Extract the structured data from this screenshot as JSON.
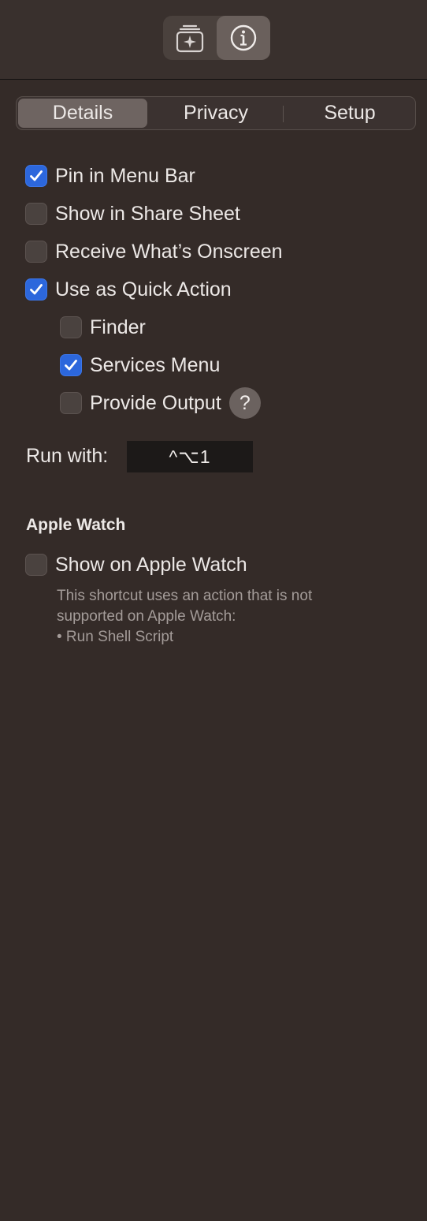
{
  "toolbar": {
    "icons": [
      {
        "name": "shortcut-details-icon",
        "selected": false
      },
      {
        "name": "info-icon",
        "selected": true
      }
    ]
  },
  "tabs": [
    {
      "label": "Details",
      "selected": true
    },
    {
      "label": "Privacy",
      "selected": false
    },
    {
      "label": "Setup",
      "selected": false
    }
  ],
  "options": {
    "pin_menu_bar": {
      "label": "Pin in Menu Bar",
      "checked": true
    },
    "share_sheet": {
      "label": "Show in Share Sheet",
      "checked": false
    },
    "onscreen": {
      "label": "Receive What’s Onscreen",
      "checked": false
    },
    "quick_action": {
      "label": "Use as Quick Action",
      "checked": true
    },
    "finder": {
      "label": "Finder",
      "checked": false
    },
    "services_menu": {
      "label": "Services Menu",
      "checked": true
    },
    "provide_output": {
      "label": "Provide Output",
      "checked": false,
      "help": "?"
    }
  },
  "run_with": {
    "label": "Run with:",
    "shortcut": "^⌥1"
  },
  "apple_watch": {
    "title": "Apple Watch",
    "show": {
      "label": "Show on Apple Watch",
      "checked": false
    },
    "note_lines": [
      "This shortcut uses an action that is not",
      "supported on Apple Watch:",
      "• Run Shell Script"
    ]
  },
  "colors": {
    "background": "#342b28",
    "accent": "#2c67dc"
  }
}
